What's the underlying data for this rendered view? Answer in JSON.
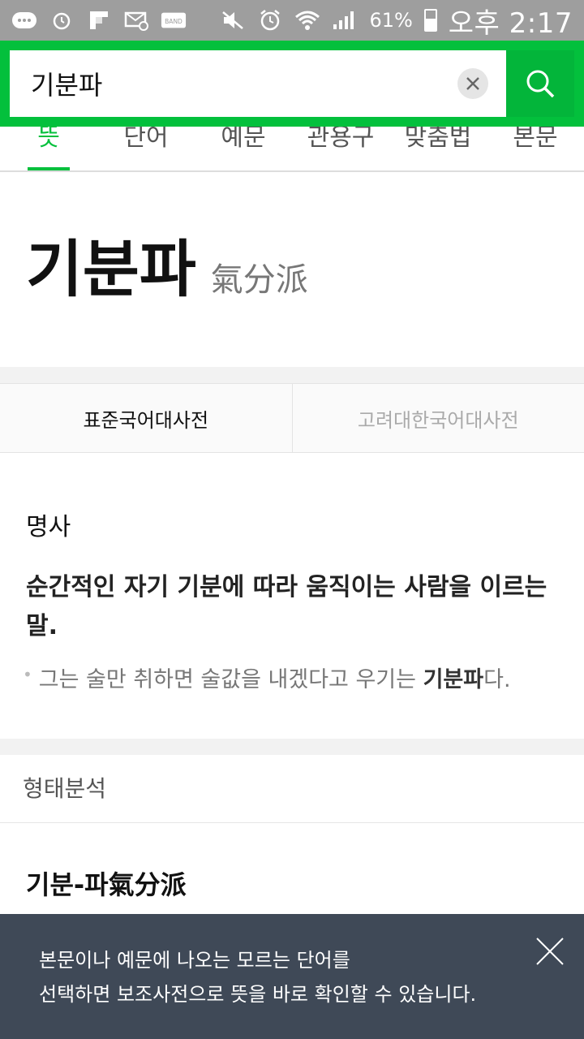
{
  "status_bar": {
    "battery_percent": "61%",
    "time": "오후 2:17"
  },
  "search": {
    "value": "기분파",
    "placeholder": ""
  },
  "tabs": {
    "items": [
      {
        "label": "뜻"
      },
      {
        "label": "단어"
      },
      {
        "label": "예문"
      },
      {
        "label": "관용구"
      },
      {
        "label": "맞춤법"
      },
      {
        "label": "본문"
      }
    ],
    "active_index": 0
  },
  "entry": {
    "word": "기분파",
    "hanja": "氣分派"
  },
  "dictionary_tabs": {
    "standard": "표준국어대사전",
    "korea_univ": "고려대한국어대사전"
  },
  "definition": {
    "part_of_speech": "명사",
    "meaning": "순간적인 자기 기분에 따라 움직이는 사람을 이르는 말.",
    "example_prefix": "그는 술만 취하면 술값을 내겠다고 우기는 ",
    "example_highlight": "기분파",
    "example_suffix": "다."
  },
  "morphology": {
    "label": "형태분석",
    "analysis": "기분-파氣分派"
  },
  "toast": {
    "line1": "본문이나 예문에 나오는 모르는 단어를",
    "line2": "선택하면 보조사전으로 뜻을 바로 확인할 수 있습니다."
  },
  "colors": {
    "brand_green": "#03c03c",
    "toast_bg": "#3f4957",
    "status_bar_bg": "#9e9e9e"
  }
}
